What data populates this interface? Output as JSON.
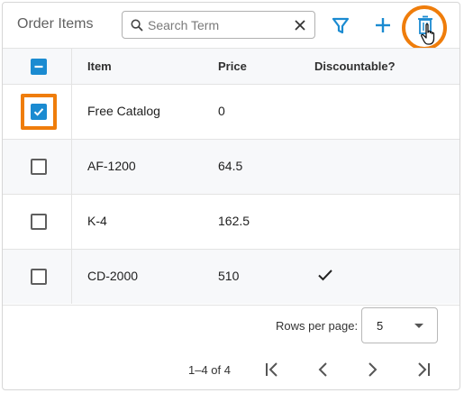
{
  "toolbar": {
    "title": "Order Items",
    "search_placeholder": "Search Term",
    "icons": {
      "search": "search-icon",
      "clear": "close-icon",
      "filter": "filter-icon",
      "add": "plus-icon",
      "delete": "trash-icon"
    }
  },
  "table": {
    "headers": [
      "Item",
      "Price",
      "Discountable?"
    ],
    "select_all_state": "indeterminate",
    "rows": [
      {
        "item": "Free Catalog",
        "price": "0",
        "discountable": false,
        "selected": true
      },
      {
        "item": "AF-1200",
        "price": "64.5",
        "discountable": false,
        "selected": false
      },
      {
        "item": "K-4",
        "price": "162.5",
        "discountable": false,
        "selected": false
      },
      {
        "item": "CD-2000",
        "price": "510",
        "discountable": true,
        "selected": false
      }
    ]
  },
  "footer": {
    "rows_per_page_label": "Rows per page:",
    "rows_per_page_value": "5",
    "range_label": "1–4 of 4"
  },
  "colors": {
    "accent": "#1b8bd1",
    "highlight": "#ef7d0b"
  }
}
